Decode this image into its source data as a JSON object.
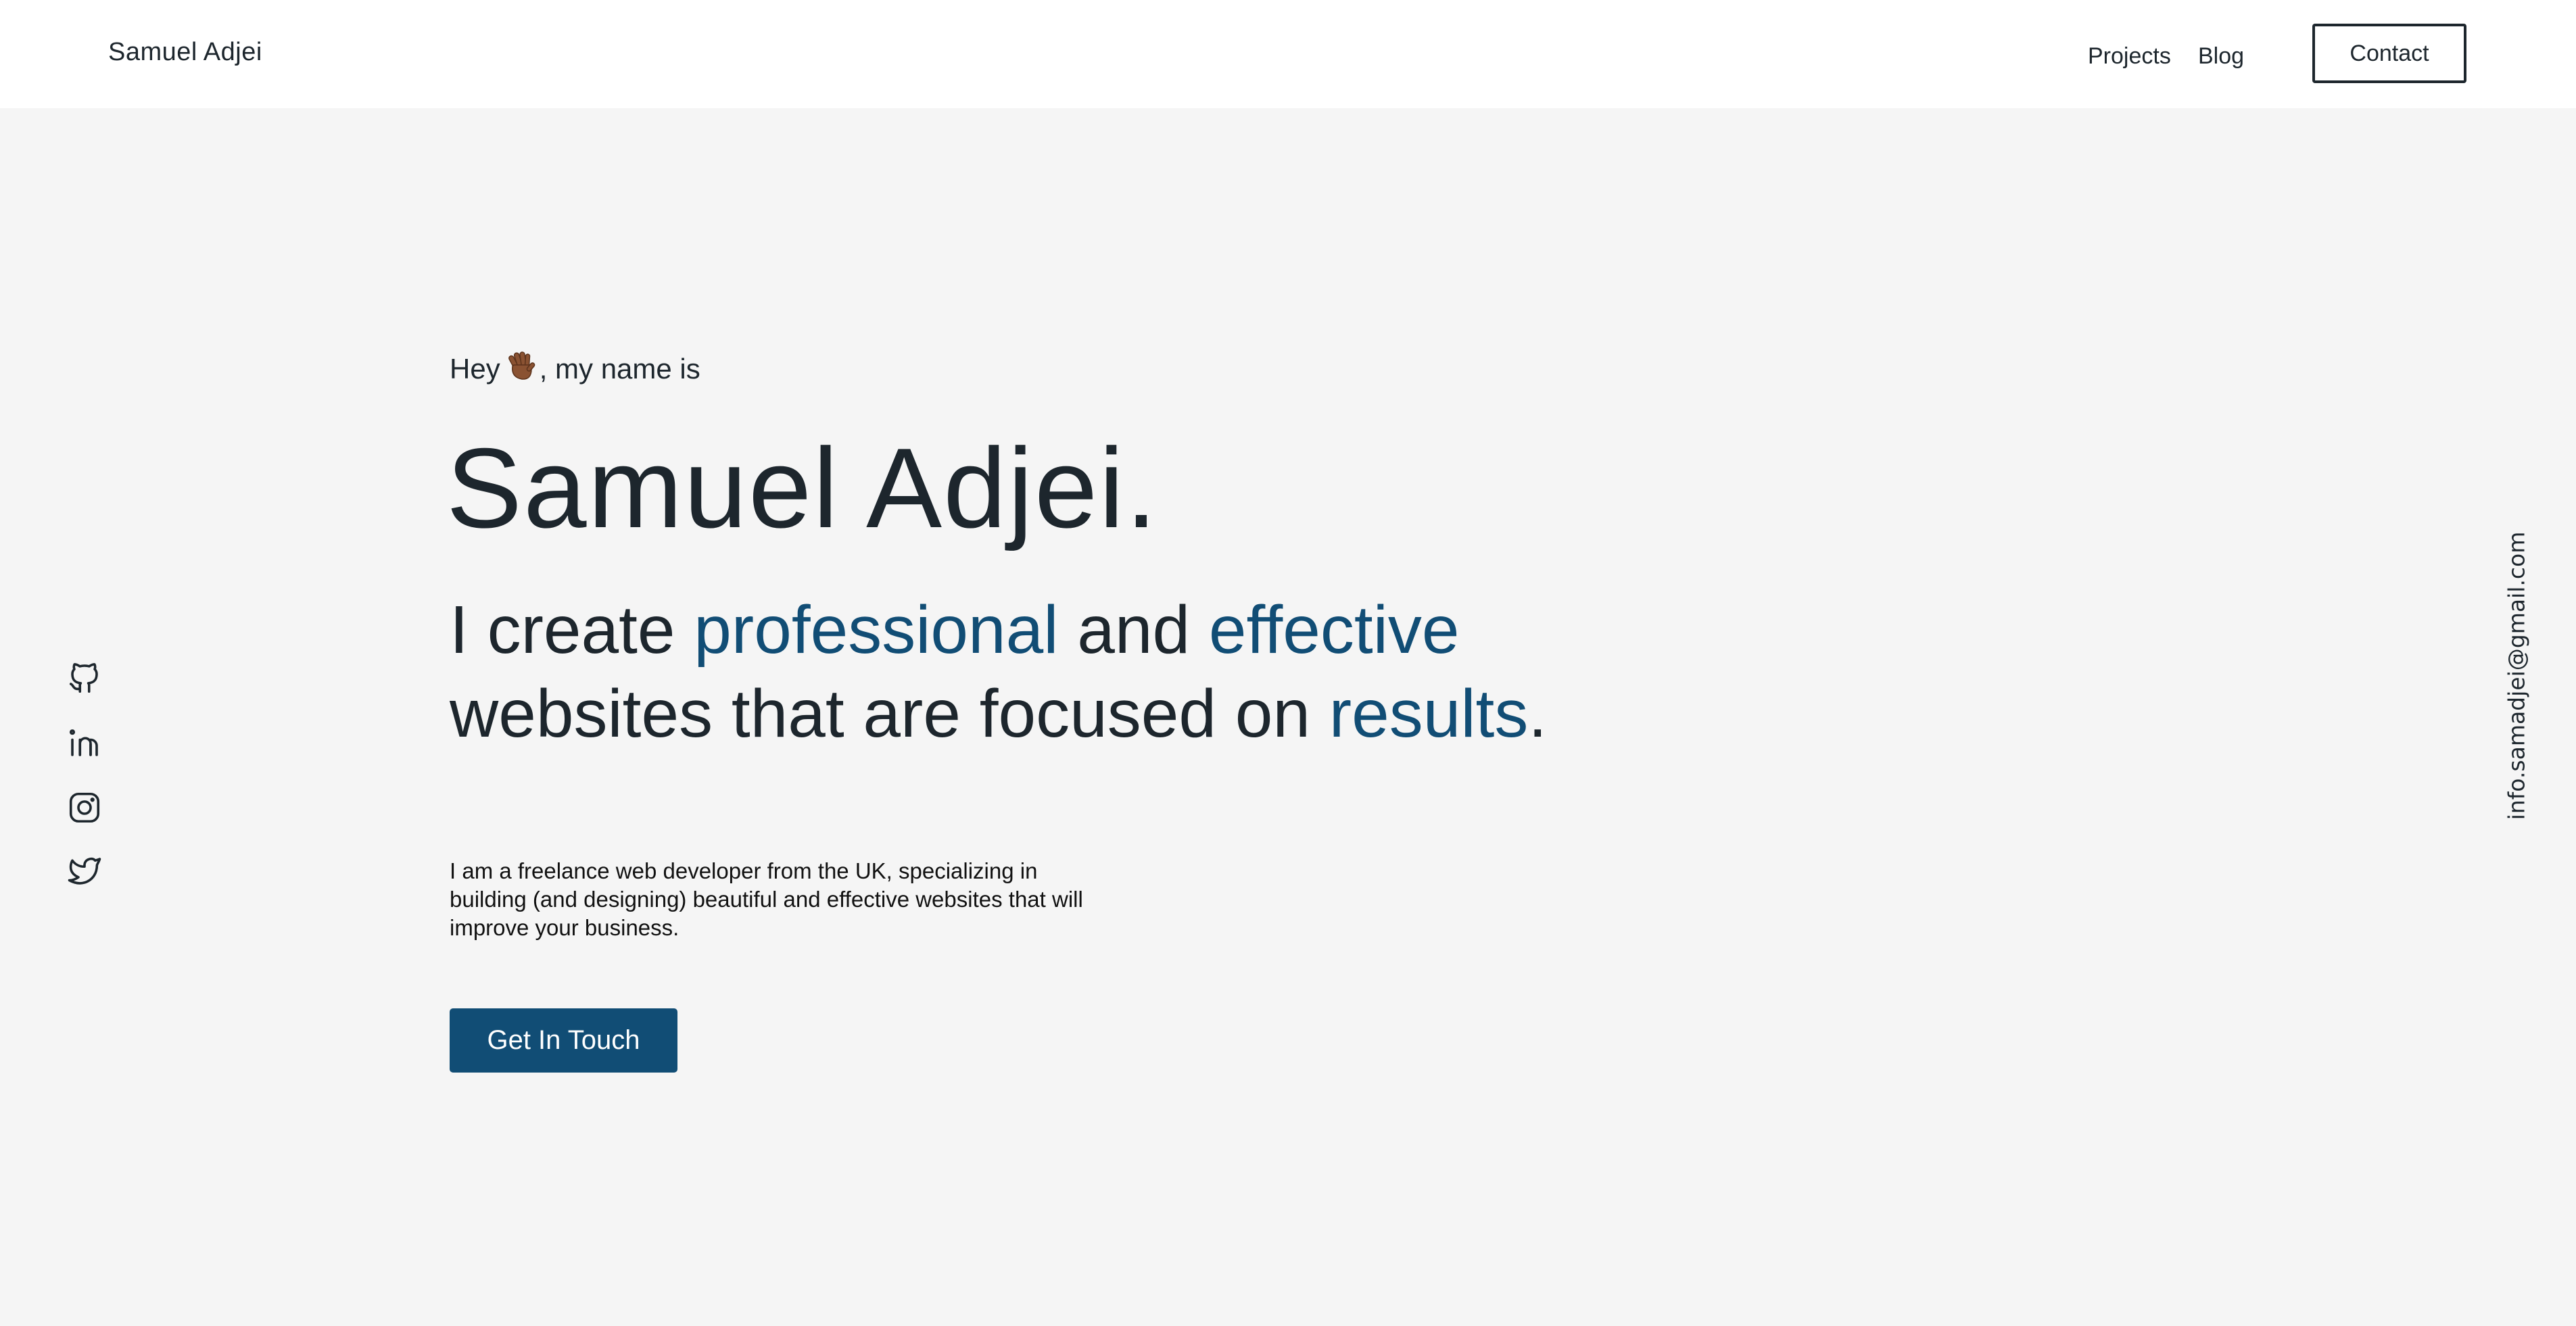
{
  "header": {
    "brand": "Samuel Adjei",
    "nav": [
      {
        "label": "Projects"
      },
      {
        "label": "Blog"
      }
    ],
    "contact_label": "Contact"
  },
  "hero": {
    "greeting_before": "Hey ",
    "greeting_emoji": "waving-hand-emoji",
    "greeting_after": ", my name is",
    "name": "Samuel Adjei.",
    "tagline": {
      "part1": "I create ",
      "highlight1": "professional",
      "part2": " and ",
      "highlight2": "effective",
      "part3": " websites that are focused on ",
      "highlight3": "results",
      "part4": "."
    },
    "bio": "I am a freelance web developer from the UK, specializing in building (and designing) beautiful and effective websites that will improve your business.",
    "cta_label": "Get In Touch"
  },
  "social": [
    {
      "icon": "github-icon"
    },
    {
      "icon": "linkedin-icon"
    },
    {
      "icon": "instagram-icon"
    },
    {
      "icon": "twitter-icon"
    }
  ],
  "email": "info.samadjei@gmail.com",
  "colors": {
    "accent": "#114d75",
    "text": "#1d262d",
    "background": "#f5f5f5",
    "header_bg": "#ffffff"
  }
}
